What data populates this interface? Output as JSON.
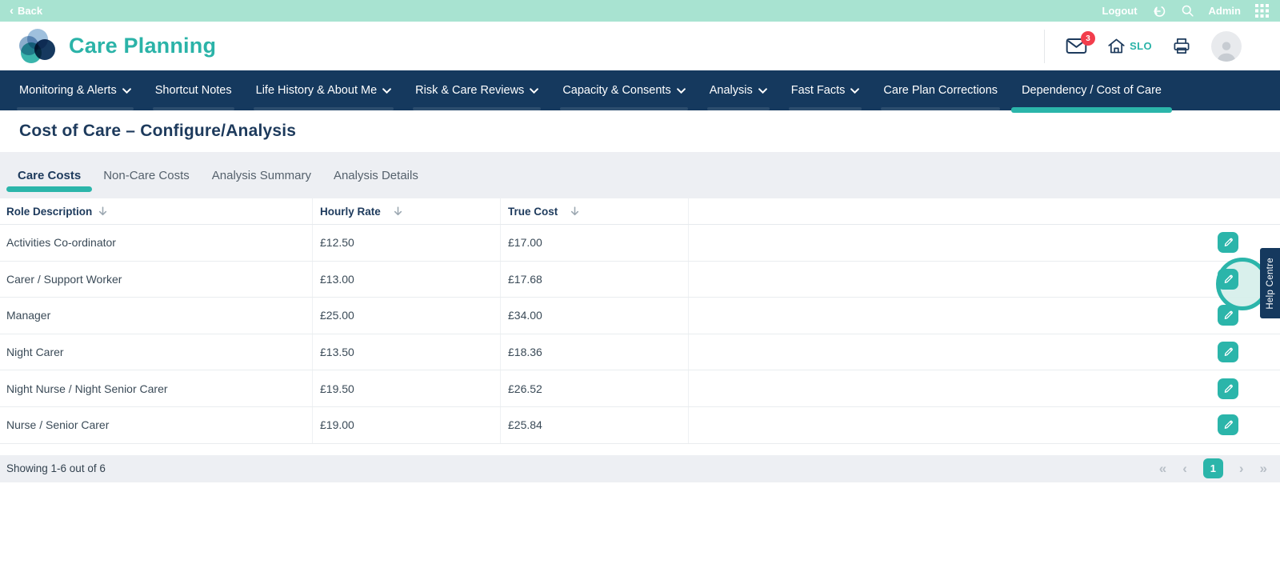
{
  "topbar": {
    "back_label": "Back",
    "logout_label": "Logout",
    "admin_label": "Admin"
  },
  "header": {
    "app_title": "Care Planning",
    "mail_badge": "3",
    "home_label": "SLO"
  },
  "nav": {
    "items": [
      {
        "label": "Monitoring & Alerts"
      },
      {
        "label": "Shortcut Notes"
      },
      {
        "label": "Life History & About Me"
      },
      {
        "label": "Risk & Care Reviews"
      },
      {
        "label": "Capacity & Consents"
      },
      {
        "label": "Analysis"
      },
      {
        "label": "Fast Facts"
      },
      {
        "label": "Care Plan Corrections"
      },
      {
        "label": "Dependency / Cost of Care"
      }
    ],
    "active_item": "Dependency / Cost of Care"
  },
  "page": {
    "title": "Cost of Care – Configure/Analysis"
  },
  "tabs": [
    {
      "label": "Care Costs",
      "active": true
    },
    {
      "label": "Non-Care Costs",
      "active": false
    },
    {
      "label": "Analysis Summary",
      "active": false
    },
    {
      "label": "Analysis Details",
      "active": false
    }
  ],
  "table": {
    "columns": [
      "Role Description",
      "Hourly Rate",
      "True Cost"
    ],
    "rows": [
      {
        "role": "Activities Co-ordinator",
        "hourly_rate": "£12.50",
        "true_cost": "£17.00"
      },
      {
        "role": "Carer / Support Worker",
        "hourly_rate": "£13.00",
        "true_cost": "£17.68"
      },
      {
        "role": "Manager",
        "hourly_rate": "£25.00",
        "true_cost": "£34.00"
      },
      {
        "role": "Night Carer",
        "hourly_rate": "£13.50",
        "true_cost": "£18.36"
      },
      {
        "role": "Night Nurse / Night Senior Carer",
        "hourly_rate": "£19.50",
        "true_cost": "£26.52"
      },
      {
        "role": "Nurse / Senior Carer",
        "hourly_rate": "£19.00",
        "true_cost": "£25.84"
      }
    ]
  },
  "footer": {
    "showing": "Showing 1-6 out of 6",
    "page": "1",
    "first_glyph": "«",
    "prev_glyph": "‹",
    "next_glyph": "›",
    "last_glyph": "»"
  },
  "help_tab": {
    "label": "Help Centre"
  },
  "colors": {
    "accent_teal": "#2bb5aa",
    "navy": "#15395e",
    "mint": "#a8e3d1",
    "badge_red": "#f23d4c",
    "tab_strip_gray": "#edeff3"
  }
}
